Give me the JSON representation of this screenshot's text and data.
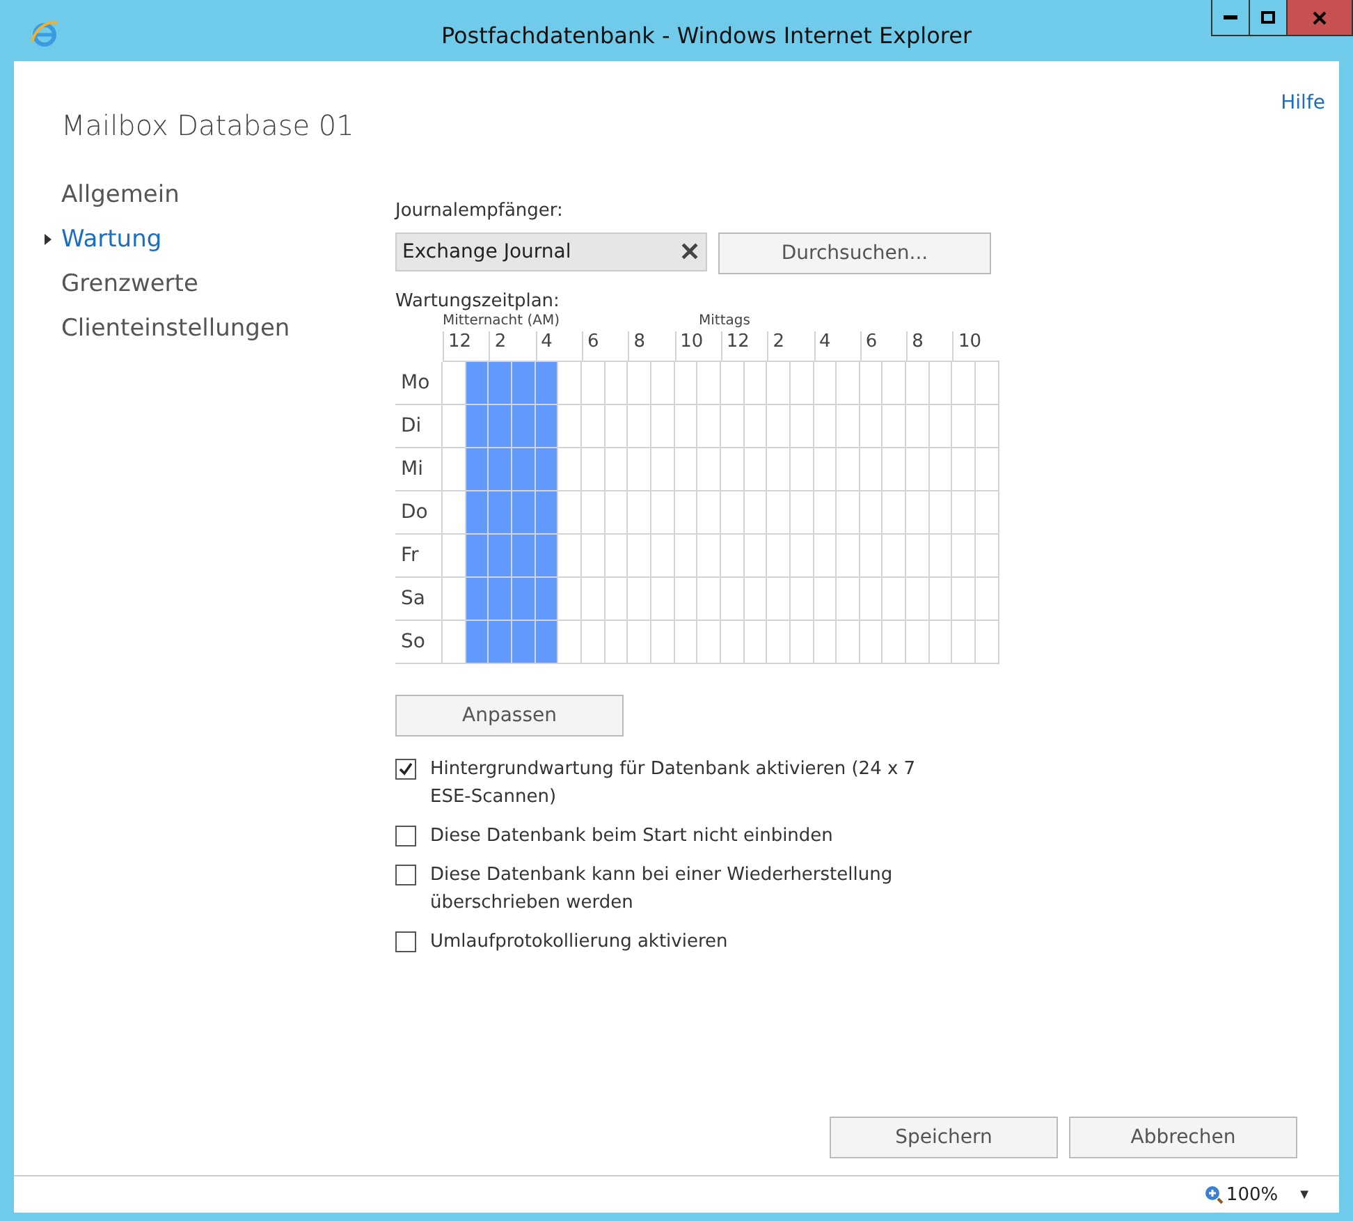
{
  "window": {
    "title": "Postfachdatenbank - Windows Internet Explorer"
  },
  "help_link": "Hilfe",
  "page_title": "Mailbox Database 01",
  "nav": [
    {
      "label": "Allgemein",
      "selected": false
    },
    {
      "label": "Wartung",
      "selected": true
    },
    {
      "label": "Grenzwerte",
      "selected": false
    },
    {
      "label": "Clienteinstellungen",
      "selected": false
    }
  ],
  "journal": {
    "label": "Journalempfänger:",
    "value": "Exchange Journal",
    "clear": "✕",
    "browse_button": "Durchsuchen..."
  },
  "schedule": {
    "label": "Wartungszeitplan:",
    "midnight_label": "Mitternacht (AM)",
    "noon_label": "Mittags",
    "hours": [
      "12",
      "2",
      "4",
      "6",
      "8",
      "10",
      "12",
      "2",
      "4",
      "6",
      "8",
      "10"
    ],
    "rows": [
      {
        "day": "Mo",
        "slots": [
          false,
          true,
          true,
          true,
          true,
          false,
          false,
          false,
          false,
          false,
          false,
          false,
          false,
          false,
          false,
          false,
          false,
          false,
          false,
          false,
          false,
          false,
          false,
          false
        ]
      },
      {
        "day": "Di",
        "slots": [
          false,
          true,
          true,
          true,
          true,
          false,
          false,
          false,
          false,
          false,
          false,
          false,
          false,
          false,
          false,
          false,
          false,
          false,
          false,
          false,
          false,
          false,
          false,
          false
        ]
      },
      {
        "day": "Mi",
        "slots": [
          false,
          true,
          true,
          true,
          true,
          false,
          false,
          false,
          false,
          false,
          false,
          false,
          false,
          false,
          false,
          false,
          false,
          false,
          false,
          false,
          false,
          false,
          false,
          false
        ]
      },
      {
        "day": "Do",
        "slots": [
          false,
          true,
          true,
          true,
          true,
          false,
          false,
          false,
          false,
          false,
          false,
          false,
          false,
          false,
          false,
          false,
          false,
          false,
          false,
          false,
          false,
          false,
          false,
          false
        ]
      },
      {
        "day": "Fr",
        "slots": [
          false,
          true,
          true,
          true,
          true,
          false,
          false,
          false,
          false,
          false,
          false,
          false,
          false,
          false,
          false,
          false,
          false,
          false,
          false,
          false,
          false,
          false,
          false,
          false
        ]
      },
      {
        "day": "Sa",
        "slots": [
          false,
          true,
          true,
          true,
          true,
          false,
          false,
          false,
          false,
          false,
          false,
          false,
          false,
          false,
          false,
          false,
          false,
          false,
          false,
          false,
          false,
          false,
          false,
          false
        ]
      },
      {
        "day": "So",
        "slots": [
          false,
          true,
          true,
          true,
          true,
          false,
          false,
          false,
          false,
          false,
          false,
          false,
          false,
          false,
          false,
          false,
          false,
          false,
          false,
          false,
          false,
          false,
          false,
          false
        ]
      }
    ],
    "customize_button": "Anpassen"
  },
  "options": [
    {
      "label": "Hintergrundwartung für Datenbank aktivieren (24 x 7 ESE-Scannen)",
      "checked": true
    },
    {
      "label": "Diese Datenbank beim Start nicht einbinden",
      "checked": false
    },
    {
      "label": "Diese Datenbank kann bei einer Wiederherstellung überschrieben werden",
      "checked": false
    },
    {
      "label": "Umlaufprotokollierung aktivieren",
      "checked": false
    }
  ],
  "buttons": [
    "Speichern",
    "Abbrechen"
  ],
  "status_bar": {
    "zoom": "100%",
    "zoom_caret": "▼"
  }
}
